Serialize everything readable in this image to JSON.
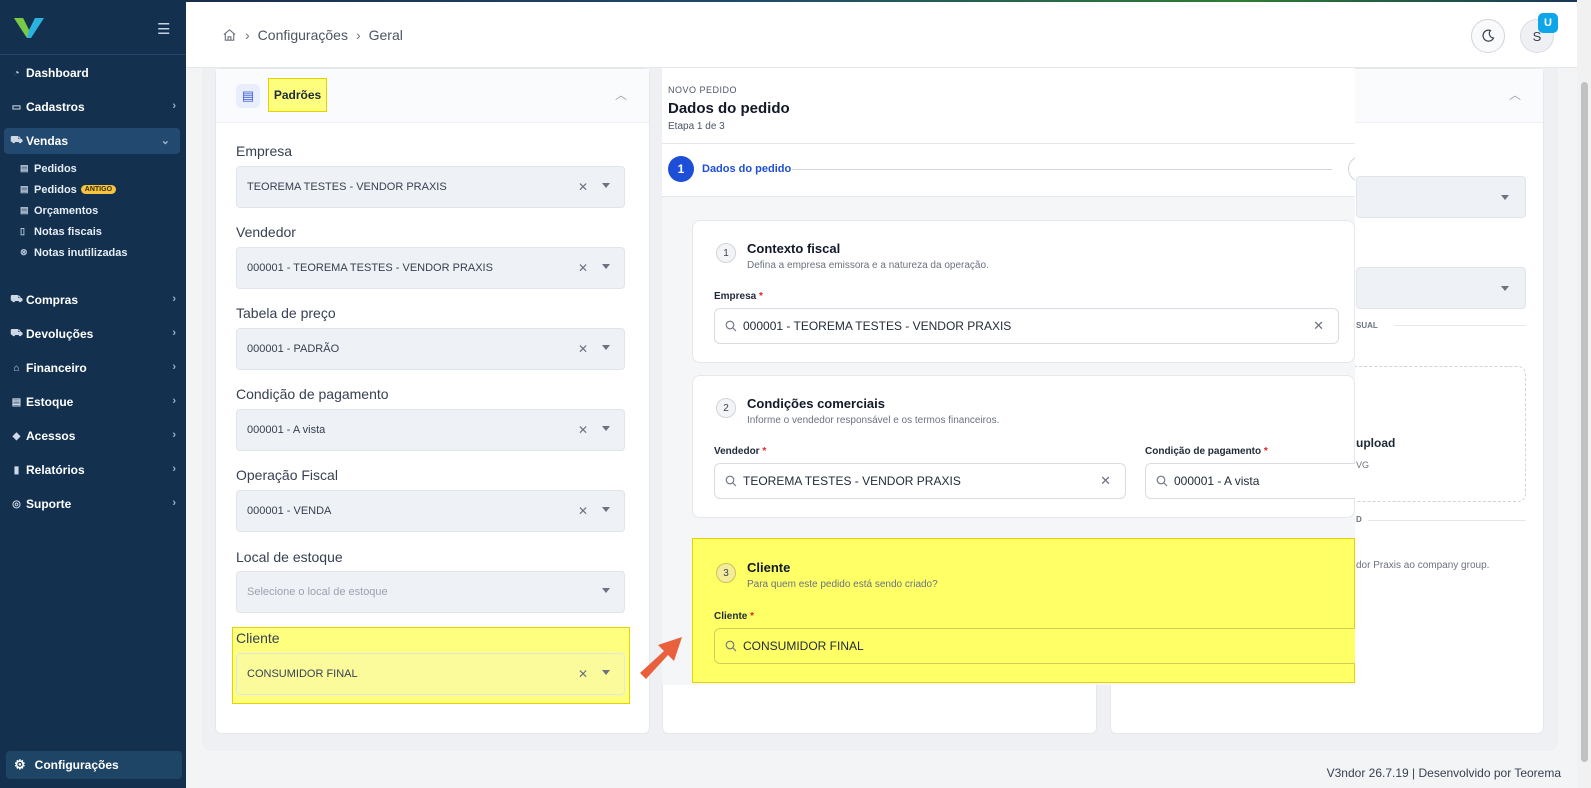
{
  "sidebar": {
    "items": [
      {
        "label": "Dashboard",
        "icon": "dashboard-icon",
        "glyph": "◔"
      },
      {
        "label": "Cadastros",
        "icon": "id-card-icon",
        "glyph": "▭"
      },
      {
        "label": "Vendas",
        "icon": "cart-icon",
        "glyph": "⛟"
      },
      {
        "label": "Compras",
        "icon": "cart-icon",
        "glyph": "⛟"
      },
      {
        "label": "Devoluções",
        "icon": "cart-icon",
        "glyph": "⛟"
      },
      {
        "label": "Financeiro",
        "icon": "bank-icon",
        "glyph": "⌂"
      },
      {
        "label": "Estoque",
        "icon": "boxes-icon",
        "glyph": "▤"
      },
      {
        "label": "Acessos",
        "icon": "shield-icon",
        "glyph": "◆"
      },
      {
        "label": "Relatórios",
        "icon": "bar-chart-icon",
        "glyph": "▮"
      },
      {
        "label": "Suporte",
        "icon": "lifebuoy-icon",
        "glyph": "◎"
      }
    ],
    "vendas_sub": [
      {
        "label": "Pedidos",
        "glyph": "▤"
      },
      {
        "label": "Pedidos",
        "glyph": "▤",
        "badge": "ANTIGO"
      },
      {
        "label": "Orçamentos",
        "glyph": "▤"
      },
      {
        "label": "Notas fiscais",
        "glyph": "▯"
      },
      {
        "label": "Notas inutilizadas",
        "glyph": "⊗"
      }
    ],
    "config_label": "Configurações"
  },
  "header": {
    "breadcrumb": [
      "Configurações",
      "Geral"
    ],
    "avatar_initial": "S",
    "avatar_badge": "U"
  },
  "padroes": {
    "title": "Padrões",
    "fields": [
      {
        "label": "Empresa",
        "value": "TEOREMA TESTES - VENDOR PRAXIS"
      },
      {
        "label": "Vendedor",
        "value": "000001 - TEOREMA TESTES - VENDOR PRAXIS"
      },
      {
        "label": "Tabela de preço",
        "value": "000001 - PADRÃO"
      },
      {
        "label": "Condição de pagamento",
        "value": "000001 - A vista"
      },
      {
        "label": "Operação Fiscal",
        "value": "000001 - VENDA"
      },
      {
        "label": "Local de estoque",
        "value": "",
        "placeholder": "Selecione o local de estoque"
      },
      {
        "label": "Cliente",
        "value": "CONSUMIDOR FINAL"
      }
    ]
  },
  "right_card": {
    "partial_label_1": "SUAL",
    "partial_upload": "upload",
    "partial_vg": "VG",
    "partial_text": "dor Praxis ao company group.",
    "partial_d": "D"
  },
  "modal": {
    "overline": "NOVO PEDIDO",
    "title": "Dados do pedido",
    "step_info": "Etapa 1 de 3",
    "step_number": "1",
    "step_label": "Dados do pedido",
    "sections": [
      {
        "num": "1",
        "title": "Contexto fiscal",
        "subtitle": "Defina a empresa emissora e a natureza da operação.",
        "field_label": "Empresa",
        "field_value": "000001 - TEOREMA TESTES - VENDOR PRAXIS"
      },
      {
        "num": "2",
        "title": "Condições comerciais",
        "subtitle": "Informe o vendedor responsável e os termos financeiros.",
        "field_label": "Vendedor",
        "field_value": "TEOREMA TESTES - VENDOR PRAXIS",
        "field2_label": "Condição de pagamento",
        "field2_value": "000001 - A vista"
      },
      {
        "num": "3",
        "title": "Cliente",
        "subtitle": "Para quem este pedido está sendo criado?",
        "field_label": "Cliente",
        "field_value": "CONSUMIDOR FINAL"
      }
    ]
  },
  "footer": {
    "text": "V3ndor 26.7.19 | Desenvolvido por Teorema"
  },
  "colors": {
    "sidebar": "#13314f",
    "primary": "#1d4ed8",
    "highlight": "#ffff4d",
    "arrow": "#e8603c"
  }
}
